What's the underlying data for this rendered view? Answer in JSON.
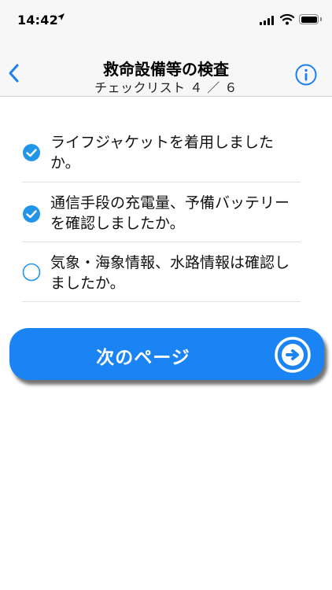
{
  "status": {
    "time": "14:42"
  },
  "nav": {
    "title": "救命設備等の検査",
    "subtitle": "チェックリスト ４ ／ ６"
  },
  "checklist": {
    "items": [
      {
        "label": "ライフジャケットを着用しましたか。",
        "checked": true
      },
      {
        "label": "通信手段の充電量、予備バッテリーを確認しましたか。",
        "checked": true
      },
      {
        "label": "気象・海象情報、水路情報は確認しましたか。",
        "checked": false
      }
    ]
  },
  "next_button": {
    "label": "次のページ"
  },
  "colors": {
    "accent": "#1a84f4",
    "check": "#2196e8"
  }
}
